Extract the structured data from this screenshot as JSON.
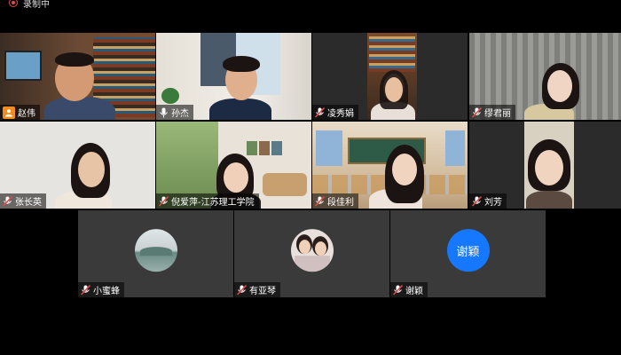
{
  "recording": {
    "label": "录制中"
  },
  "participants": [
    {
      "name": "赵伟",
      "host": true
    },
    {
      "name": "孙杰"
    },
    {
      "name": "凌秀娟"
    },
    {
      "name": "缪君丽"
    },
    {
      "name": "张长英"
    },
    {
      "name": "倪爱萍-江苏理工学院"
    },
    {
      "name": "段佳利"
    },
    {
      "name": "刘芳"
    },
    {
      "name": "小蜜蜂"
    },
    {
      "name": "有亚琴"
    },
    {
      "name": "谢颖",
      "avatar_text": "谢颖"
    }
  ],
  "colors": {
    "muted_mic": "#e24a4a",
    "host_badge": "#f08c1b",
    "avatar_blue": "#1677ff",
    "tile_bg": "#3a3a3a"
  }
}
